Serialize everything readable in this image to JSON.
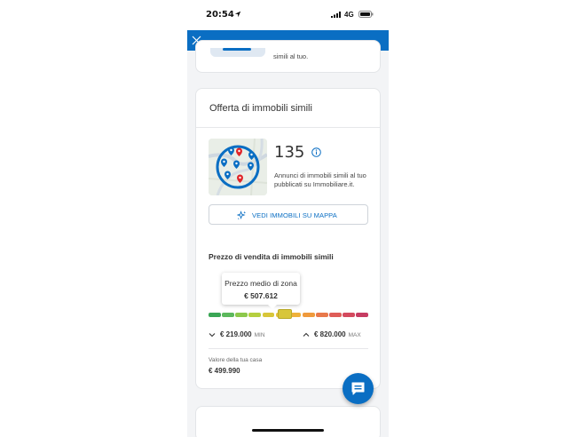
{
  "status_bar": {
    "time": "20:54",
    "network": "4G"
  },
  "top_card": {
    "text": "simili al tuo."
  },
  "offer_card": {
    "title": "Offerta di immobili simili",
    "count": "135",
    "description": "Annunci di immobili simili al tuo pubblicati su Immobiliare.it.",
    "map_button_label": "VEDI IMMOBILI SU MAPPA"
  },
  "price_section": {
    "title": "Prezzo di vendita di immobili simili",
    "tooltip_label": "Prezzo medio di zona",
    "tooltip_value": "€ 507.612",
    "min_value": "€ 219.000",
    "min_tag": "MIN",
    "max_value": "€ 820.000",
    "max_tag": "MAX",
    "average_position_fraction": 0.48,
    "home_label": "Valore della tua casa",
    "home_value": "€ 499.990"
  },
  "colors": {
    "brand_blue": "#0a6ec3",
    "gauge": [
      "#3aa655",
      "#5cb85c",
      "#8cc84b",
      "#b5cf3f",
      "#d8c63a",
      "#e6c33a",
      "#efb13a",
      "#ef9a3c",
      "#e8784a",
      "#df5d58",
      "#d44a5e",
      "#c63c62"
    ]
  },
  "icons": {
    "close": "close-icon",
    "info": "info-icon",
    "sparkle": "sparkle-icon",
    "chat": "chat-icon",
    "location": "location-arrow-icon",
    "signal": "signal-icon",
    "battery": "battery-icon"
  }
}
